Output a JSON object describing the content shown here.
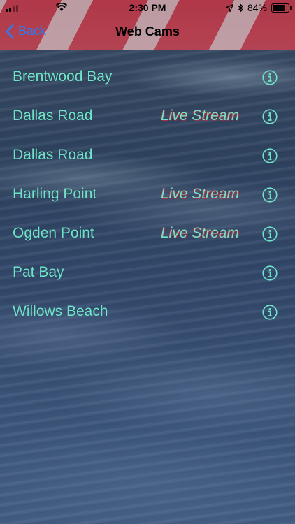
{
  "status_bar": {
    "time": "2:30 PM",
    "battery_percent": "84%",
    "battery_level": 0.84,
    "icons": [
      "signal-icon",
      "wifi-icon",
      "location-arrow-icon",
      "bluetooth-icon",
      "battery-icon"
    ]
  },
  "nav": {
    "back_label": "Back",
    "title": "Web Cams"
  },
  "colors": {
    "item_text": "#6fe3c8",
    "back_blue": "#2a7cf6",
    "stream_shadow": "#be283c"
  },
  "webcams": [
    {
      "name": "Brentwood Bay",
      "stream": ""
    },
    {
      "name": "Dallas Road",
      "stream": "Live Stream"
    },
    {
      "name": "Dallas Road",
      "stream": ""
    },
    {
      "name": "Harling Point",
      "stream": "Live Stream"
    },
    {
      "name": "Ogden Point",
      "stream": "Live Stream"
    },
    {
      "name": "Pat Bay",
      "stream": ""
    },
    {
      "name": "Willows Beach",
      "stream": ""
    }
  ]
}
